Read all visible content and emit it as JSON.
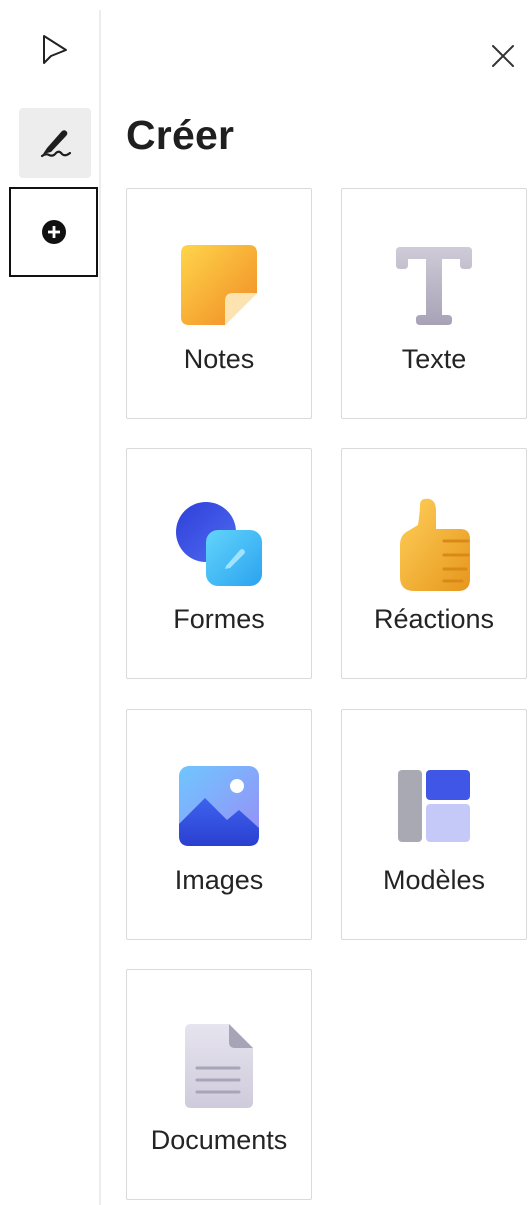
{
  "toolbar": {
    "items": [
      {
        "id": "select",
        "icon": "cursor-arrow-icon"
      },
      {
        "id": "ink",
        "icon": "pen-icon"
      },
      {
        "id": "create",
        "icon": "plus-circle-icon"
      }
    ]
  },
  "panel": {
    "title": "Créer",
    "close_icon": "close-icon",
    "cards": [
      {
        "label": "Notes",
        "icon": "sticky-note-icon"
      },
      {
        "label": "Texte",
        "icon": "text-icon"
      },
      {
        "label": "Formes",
        "icon": "shapes-icon"
      },
      {
        "label": "Réactions",
        "icon": "thumbs-up-icon"
      },
      {
        "label": "Images",
        "icon": "image-icon"
      },
      {
        "label": "Modèles",
        "icon": "template-icon"
      },
      {
        "label": "Documents",
        "icon": "document-icon"
      }
    ]
  },
  "colors": {
    "note_yellow": "#f7b734",
    "shape_blue": "#3b5be8",
    "shape_cyan": "#4fc3f7",
    "thumb_yellow": "#f5b62e",
    "template_blue": "#3f56e6",
    "image_blue": "#3e63ee"
  }
}
